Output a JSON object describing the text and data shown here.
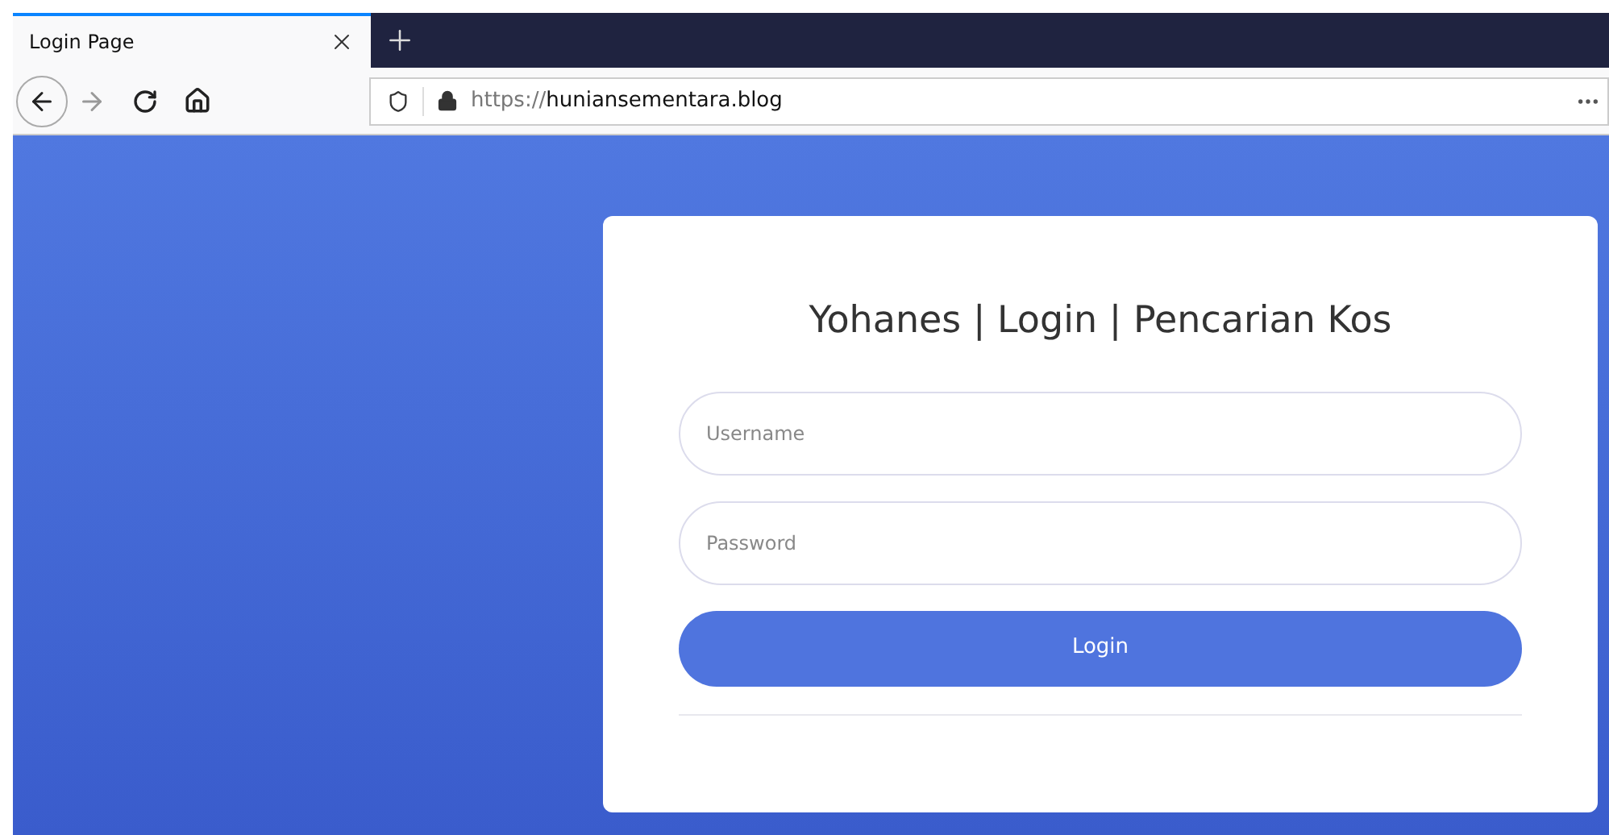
{
  "tabs": [
    {
      "label": "Login Page",
      "selected": true
    }
  ],
  "address_bar": {
    "scheme": "https://",
    "host": "huniansementara.blog"
  },
  "login_card": {
    "title": "Yohanes | Login | Pencarian Kos",
    "fields": [
      {
        "placeholder": "Username"
      },
      {
        "placeholder": "Password"
      }
    ],
    "button": "Login"
  }
}
